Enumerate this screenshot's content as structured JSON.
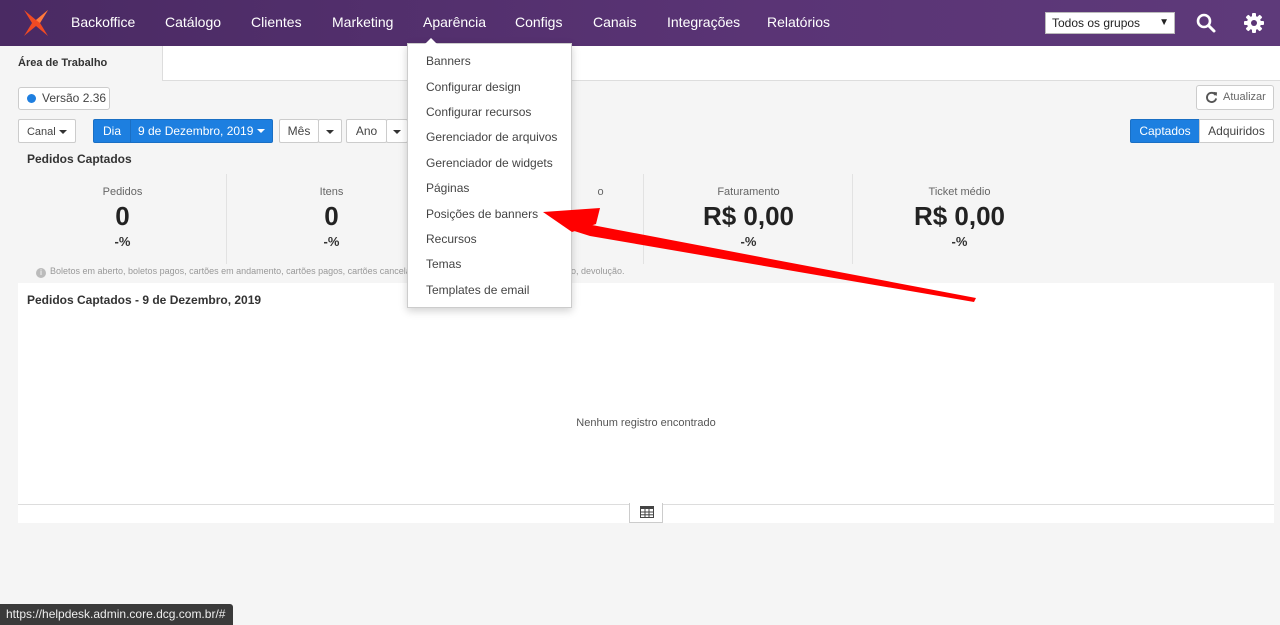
{
  "nav": {
    "items": [
      "Backoffice",
      "Catálogo",
      "Clientes",
      "Marketing",
      "Aparência",
      "Configs",
      "Canais",
      "Integrações",
      "Relatórios"
    ],
    "group_select": "Todos os grupos"
  },
  "tabs": {
    "active": "Área de Trabalho"
  },
  "version": "Versão 2.36",
  "refresh_label": "Atualizar",
  "filters": {
    "channel": "Canal",
    "day": "Dia",
    "date": "9 de Dezembro, 2019",
    "month": "Mês",
    "year": "Ano",
    "captured": "Captados",
    "acquired": "Adquiridos"
  },
  "section_title": "Pedidos Captados",
  "kpis": [
    {
      "label": "Pedidos",
      "value": "0",
      "delta": "-%"
    },
    {
      "label": "Itens",
      "value": "0",
      "delta": "-%"
    },
    {
      "label": "o",
      "value": "",
      "delta": ""
    },
    {
      "label": "Faturamento",
      "value": "R$ 0,00",
      "delta": "-%"
    },
    {
      "label": "Ticket médio",
      "value": "R$ 0,00",
      "delta": "-%"
    }
  ],
  "note_start": "Boletos em aberto, boletos pagos, cartões em andamento, cartões pagos, cartões cancelados, b",
  "note_end": "ho, devolução.",
  "panel": {
    "title": "Pedidos Captados - 9 de Dezembro, 2019",
    "empty": "Nenhum registro encontrado"
  },
  "dropdown": {
    "items": [
      "Banners",
      "Configurar design",
      "Configurar recursos",
      "Gerenciador de arquivos",
      "Gerenciador de widgets",
      "Páginas",
      "Posições de banners",
      "Recursos",
      "Temas",
      "Templates de email"
    ]
  },
  "status_url": "https://helpdesk.admin.core.dcg.com.br/#",
  "colors": {
    "nav": "#4a2a63",
    "primary": "#1d7fe0",
    "arrow": "#ff0000",
    "logo": "#f04a23"
  }
}
